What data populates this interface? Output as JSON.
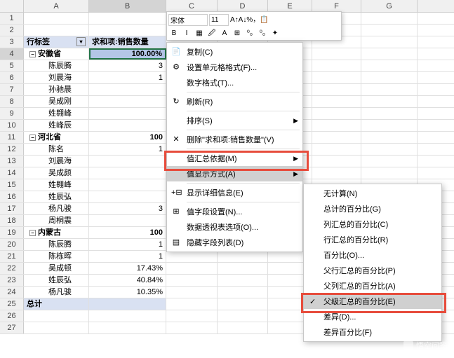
{
  "columns": [
    "A",
    "B",
    "C",
    "D",
    "E",
    "F",
    "G"
  ],
  "mini": {
    "font": "宋体",
    "size": "11",
    "btns_row1": [
      "A↑",
      "A↓",
      "%",
      "，",
      "📋"
    ],
    "btns_row2": [
      "B",
      "I",
      "▦",
      "🖉",
      "A",
      "⊞",
      "⁰₀",
      "⁰₀",
      "✦"
    ]
  },
  "rows": [
    {
      "n": "1",
      "a": "",
      "b": ""
    },
    {
      "n": "2",
      "a": "",
      "b": ""
    },
    {
      "n": "3",
      "a": "行标签",
      "b": "求和项:销售数量",
      "hdr": true,
      "dd": true
    },
    {
      "n": "4",
      "a": "安徽省",
      "b": "100.00%",
      "grp": true,
      "sel": true
    },
    {
      "n": "5",
      "a": "陈辰腾",
      "b": "3"
    },
    {
      "n": "6",
      "a": "刘晨海",
      "b": "1"
    },
    {
      "n": "7",
      "a": "孙驰晨",
      "b": ""
    },
    {
      "n": "8",
      "a": "吴成刚",
      "b": ""
    },
    {
      "n": "9",
      "a": "姓翱峰",
      "b": ""
    },
    {
      "n": "10",
      "a": "姓峰辰",
      "b": ""
    },
    {
      "n": "11",
      "a": "河北省",
      "b": "100",
      "grp": true
    },
    {
      "n": "12",
      "a": "陈名",
      "b": "1"
    },
    {
      "n": "13",
      "a": "刘晨海",
      "b": ""
    },
    {
      "n": "14",
      "a": "吴成颜",
      "b": ""
    },
    {
      "n": "15",
      "a": "姓翱峰",
      "b": ""
    },
    {
      "n": "16",
      "a": "姓辰弘",
      "b": ""
    },
    {
      "n": "17",
      "a": "杨凡骏",
      "b": "3"
    },
    {
      "n": "18",
      "a": "周桐震",
      "b": ""
    },
    {
      "n": "19",
      "a": "内蒙古",
      "b": "100",
      "grp": true
    },
    {
      "n": "20",
      "a": "陈辰腾",
      "b": "1"
    },
    {
      "n": "21",
      "a": "陈栋晖",
      "b": "1"
    },
    {
      "n": "22",
      "a": "吴成顿",
      "b": "17.43%"
    },
    {
      "n": "23",
      "a": "姓辰弘",
      "b": "40.84%"
    },
    {
      "n": "24",
      "a": "杨凡骏",
      "b": "10.35%"
    },
    {
      "n": "25",
      "a": "总计",
      "b": "",
      "total": true
    },
    {
      "n": "26",
      "a": "",
      "b": ""
    },
    {
      "n": "27",
      "a": "",
      "b": ""
    }
  ],
  "menu": [
    {
      "icon": "📄",
      "label": "复制(C)"
    },
    {
      "icon": "⚙",
      "label": "设置单元格格式(F)..."
    },
    {
      "label": "数字格式(T)...",
      "sep_after": true
    },
    {
      "icon": "↻",
      "label": "刷新(R)",
      "sep_after": true
    },
    {
      "label": "排序(S)",
      "arrow": true,
      "sep_after": true
    },
    {
      "icon": "✕",
      "label": "删除\"求和项:销售数量\"(V)",
      "sep_after": true
    },
    {
      "label": "值汇总依据(M)",
      "arrow": true
    },
    {
      "label": "值显示方式(A)",
      "arrow": true,
      "hl": true,
      "sep_after": true
    },
    {
      "icon": "+⊟",
      "label": "显示详细信息(E)",
      "sep_after": true
    },
    {
      "icon": "⊞",
      "label": "值字段设置(N)..."
    },
    {
      "label": "数据透视表选项(O)..."
    },
    {
      "icon": "▤",
      "label": "隐藏字段列表(D)"
    }
  ],
  "submenu": [
    {
      "label": "无计算(N)"
    },
    {
      "label": "总计的百分比(G)"
    },
    {
      "label": "列汇总的百分比(C)"
    },
    {
      "label": "行汇总的百分比(R)"
    },
    {
      "label": "百分比(O)..."
    },
    {
      "label": "父行汇总的百分比(P)"
    },
    {
      "label": "父列汇总的百分比(A)"
    },
    {
      "label": "父级汇总的百分比(E)",
      "hl": true,
      "check": true
    },
    {
      "label": "差异(D)..."
    },
    {
      "label": "差异百分比(F)"
    }
  ],
  "watermark": "悟空问答"
}
